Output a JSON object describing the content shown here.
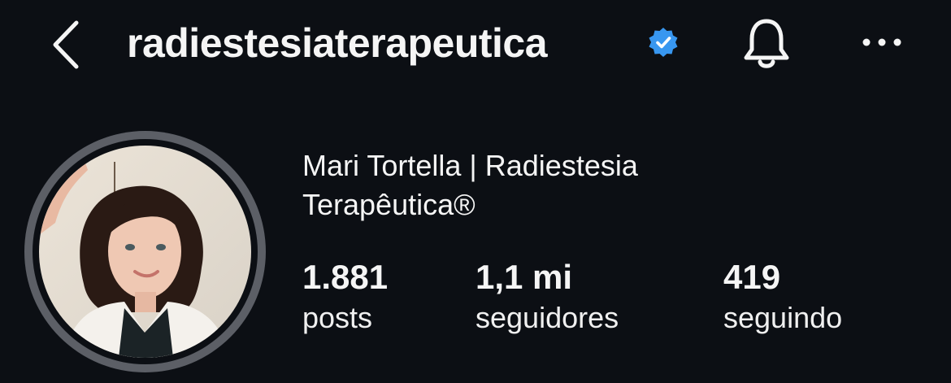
{
  "header": {
    "username": "radiestesiaterapeutica",
    "icons": {
      "back": "chevron-left-icon",
      "verified": "verified-badge-icon",
      "notifications": "bell-icon",
      "more": "more-horizontal-icon"
    }
  },
  "profile": {
    "display_name": "Mari Tortella | Radiestesia Terapêutica®",
    "stats": [
      {
        "value": "1.881",
        "label": "posts"
      },
      {
        "value": "1,1 mi",
        "label": "seguidores"
      },
      {
        "value": "419",
        "label": "seguindo"
      }
    ]
  },
  "colors": {
    "background": "#0c0f14",
    "text": "#f5f5f5",
    "verified": "#3897f0",
    "avatar_ring": "#5c5f66"
  }
}
